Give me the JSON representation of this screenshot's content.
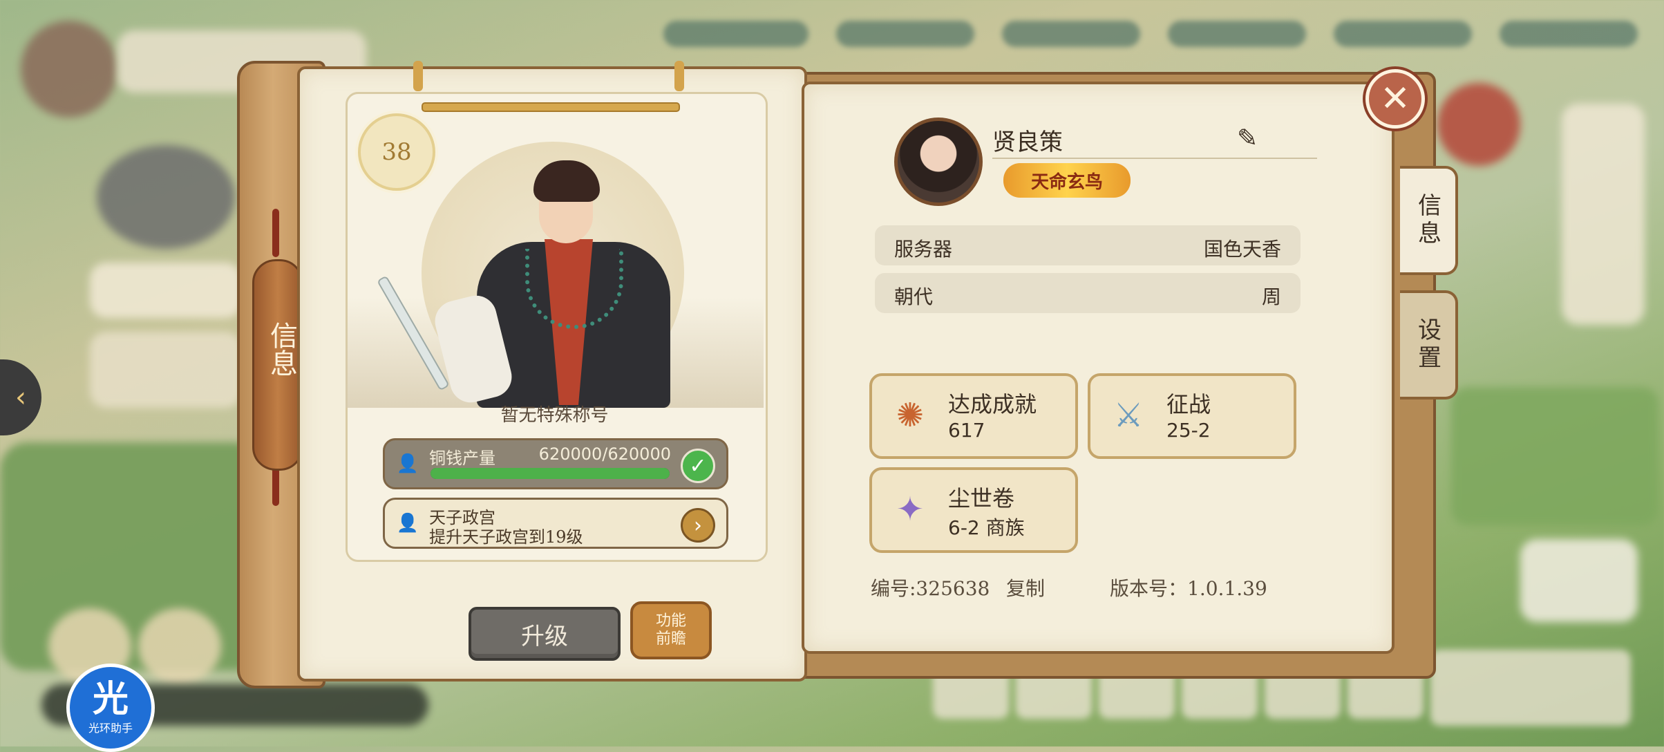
{
  "window": {
    "width": 2408,
    "height": 1080
  },
  "left_page": {
    "level": "38",
    "special_title": "暂无特殊称号",
    "copper_task": {
      "label": "铜钱产量",
      "value": "620000/620000",
      "progress_fraction": 1.0,
      "status_icon": "check-icon"
    },
    "palace_task": {
      "label": "天子政宫",
      "desc": "提升天子政宫到19级",
      "action_icon": "chevron-right-icon"
    },
    "upgrade_label": "升级",
    "preview_label_line1": "功能",
    "preview_label_line2": "前瞻",
    "spine_tab_label": "信息"
  },
  "right_page": {
    "player_name": "贤良策",
    "title_badge": "天命玄鸟",
    "info_rows": [
      {
        "label": "服务器",
        "value": "国色天香"
      },
      {
        "label": "朝代",
        "value": "周"
      }
    ],
    "stats": [
      {
        "label": "达成成就",
        "value": "617",
        "icon": "phoenix-icon"
      },
      {
        "label": "征战",
        "value": "25-2",
        "icon": "crossed-swords-icon"
      },
      {
        "label": "尘世卷",
        "value": "6-2 商族",
        "icon": "beast-icon"
      }
    ],
    "id_text": "编号:325638",
    "copy_label": "复制",
    "version_text": "版本号：1.0.1.39"
  },
  "side_tabs": [
    {
      "label": "信息",
      "active": true
    },
    {
      "label": "设置",
      "active": false
    }
  ],
  "assist_logo": {
    "big": "光",
    "small": "光环助手"
  },
  "colors": {
    "paper": "#f4eedb",
    "wood": "#b98a55",
    "progress_green": "#4db14a",
    "title_gold": "#ffd34d"
  }
}
